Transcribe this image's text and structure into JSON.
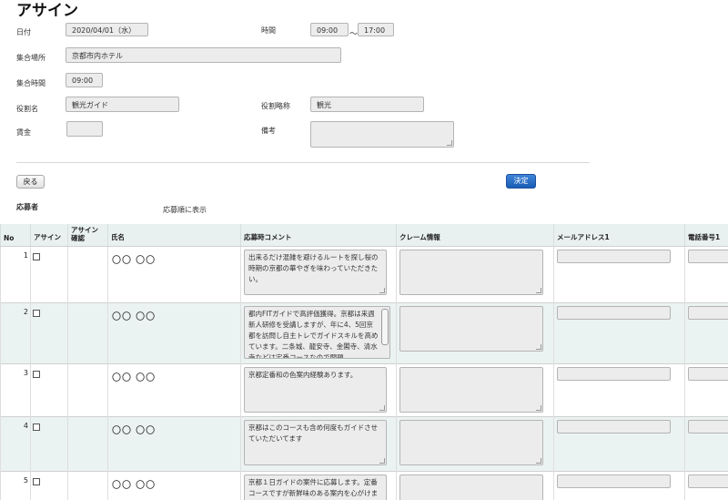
{
  "page_title": "アサイン",
  "form": {
    "date_label": "日付",
    "date_value": "2020/04/01（水）",
    "time_label": "時間",
    "time_start": "09:00",
    "time_sep": "～",
    "time_end": "17:00",
    "meeting_place_label": "集合場所",
    "meeting_place_value": "京都市内ホテル",
    "meeting_time_label": "集合時間",
    "meeting_time_value": "09:00",
    "role_name_label": "役割名",
    "role_name_value": "観光ガイド",
    "role_abbr_label": "役割略称",
    "role_abbr_value": "観光",
    "wage_label": "賃金",
    "wage_value": "",
    "remarks_label": "備考",
    "remarks_value": ""
  },
  "buttons": {
    "back": "戻る",
    "decide": "決定"
  },
  "applicants": {
    "heading": "応募者",
    "sort_note": "応募順に表示"
  },
  "table": {
    "headers": {
      "no": "No",
      "assign": "アサイン",
      "assign_confirm": "アサイン\n確認",
      "name": "氏名",
      "comment": "応募時コメント",
      "claim": "クレーム情報",
      "email": "メールアドレス1",
      "phone": "電話番号1"
    },
    "rows": [
      {
        "no": "1",
        "name": "〇〇 〇〇",
        "comment": "出来るだけ混雑を避けるルートを探し桜の時期の京都の華やぎを味わっていただきたい。"
      },
      {
        "no": "2",
        "name": "〇〇 〇〇",
        "comment": "都内FITガイドで高評価獲得。京都は来週新人研修を受講しますが、年に4、5回京都を訪問し自主トレでガイドスキルを高めています。二条城、龍安寺、金閣寺、清水寺などは定番コースなので問題"
      },
      {
        "no": "3",
        "name": "〇〇 〇〇",
        "comment": "京都定番和の色案内経験あります。"
      },
      {
        "no": "4",
        "name": "〇〇 〇〇",
        "comment": "京都はこのコースも含め何度もガイドさせていただいてます"
      },
      {
        "no": "5",
        "name": "〇〇 〇〇",
        "comment": "京都１日ガイドの案件に応募します。定番コースですが新鮮味のある案内を心がけま"
      }
    ]
  }
}
